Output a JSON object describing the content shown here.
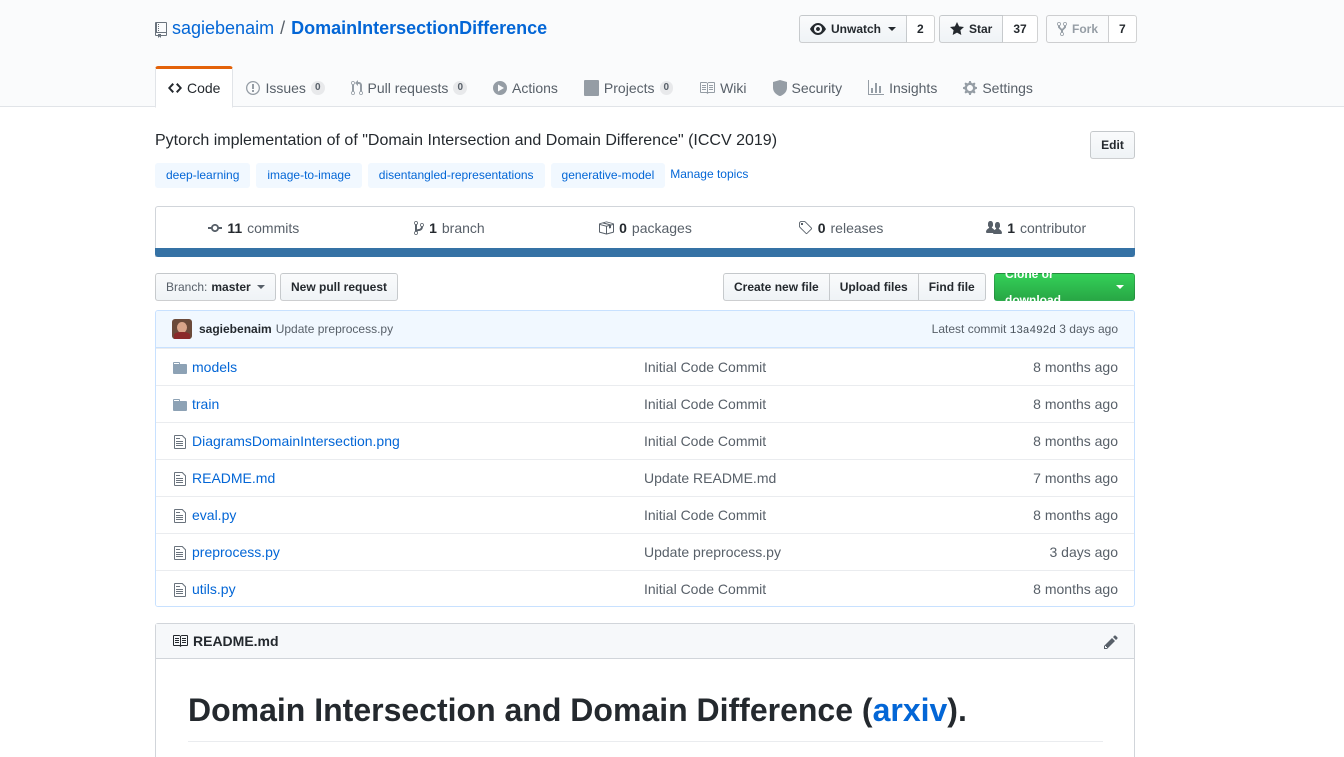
{
  "repo": {
    "owner": "sagiebenaim",
    "separator": "/",
    "name": "DomainIntersectionDifference",
    "description": "Pytorch implementation of of \"Domain Intersection and Domain Difference\" (ICCV 2019)",
    "edit_label": "Edit"
  },
  "actions": {
    "watch": {
      "label": "Unwatch",
      "count": "2"
    },
    "star": {
      "label": "Star",
      "count": "37"
    },
    "fork": {
      "label": "Fork",
      "count": "7"
    }
  },
  "nav": [
    {
      "label": "Code",
      "icon": "code-icon",
      "counter": ""
    },
    {
      "label": "Issues",
      "icon": "issue-icon",
      "counter": "0"
    },
    {
      "label": "Pull requests",
      "icon": "pull-request-icon",
      "counter": "0"
    },
    {
      "label": "Actions",
      "icon": "play-icon",
      "counter": ""
    },
    {
      "label": "Projects",
      "icon": "project-icon",
      "counter": "0"
    },
    {
      "label": "Wiki",
      "icon": "book-icon",
      "counter": ""
    },
    {
      "label": "Security",
      "icon": "shield-icon",
      "counter": ""
    },
    {
      "label": "Insights",
      "icon": "graph-icon",
      "counter": ""
    },
    {
      "label": "Settings",
      "icon": "gear-icon",
      "counter": ""
    }
  ],
  "topics": [
    "deep-learning",
    "image-to-image",
    "disentangled-representations",
    "generative-model"
  ],
  "manage_topics": "Manage topics",
  "summary": [
    {
      "count": "11",
      "label": "commits",
      "icon": "history-icon"
    },
    {
      "count": "1",
      "label": "branch",
      "icon": "branch-icon"
    },
    {
      "count": "0",
      "label": "packages",
      "icon": "package-icon"
    },
    {
      "count": "0",
      "label": "releases",
      "icon": "tag-icon"
    },
    {
      "count": "1",
      "label": "contributor",
      "icon": "people-icon"
    }
  ],
  "language_color": "#3572A5",
  "file_nav": {
    "branch_prefix": "Branch:",
    "branch": "master",
    "new_pr": "New pull request",
    "create_file": "Create new file",
    "upload": "Upload files",
    "find": "Find file",
    "clone": "Clone or download"
  },
  "latest_commit": {
    "author": "sagiebenaim",
    "message": "Update preprocess.py",
    "prefix": "Latest commit",
    "sha": "13a492d",
    "age": "3 days ago"
  },
  "files": [
    {
      "name": "models",
      "type": "dir",
      "message": "Initial Code Commit",
      "age": "8 months ago"
    },
    {
      "name": "train",
      "type": "dir",
      "message": "Initial Code Commit",
      "age": "8 months ago"
    },
    {
      "name": "DiagramsDomainIntersection.png",
      "type": "file",
      "message": "Initial Code Commit",
      "age": "8 months ago"
    },
    {
      "name": "README.md",
      "type": "file",
      "message": "Update README.md",
      "age": "7 months ago"
    },
    {
      "name": "eval.py",
      "type": "file",
      "message": "Initial Code Commit",
      "age": "8 months ago"
    },
    {
      "name": "preprocess.py",
      "type": "file",
      "message": "Update preprocess.py",
      "age": "3 days ago"
    },
    {
      "name": "utils.py",
      "type": "file",
      "message": "Initial Code Commit",
      "age": "8 months ago"
    }
  ],
  "readme": {
    "filename": "README.md",
    "heading_prefix": "Domain Intersection and Domain Difference (",
    "heading_link": "arxiv",
    "heading_suffix": ")."
  }
}
